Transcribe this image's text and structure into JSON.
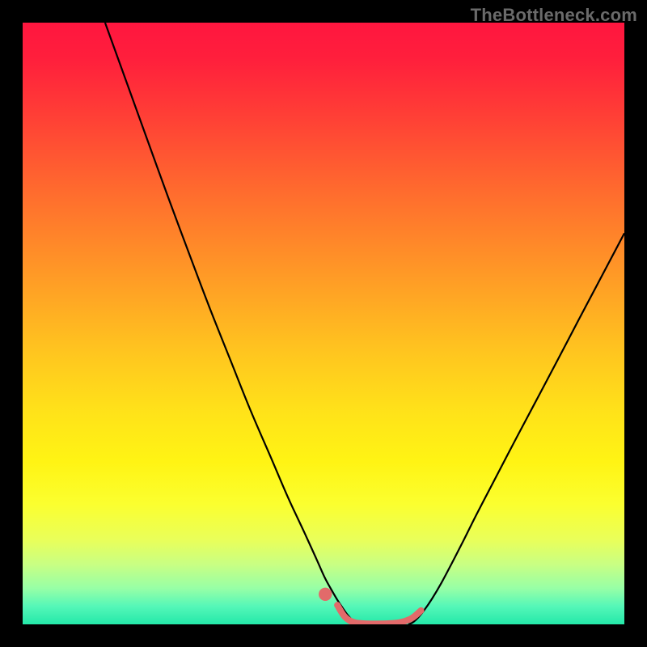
{
  "watermark": "TheBottleneck.com",
  "chart_data": {
    "type": "line",
    "title": "",
    "xlabel": "",
    "ylabel": "",
    "xlim": [
      0,
      100
    ],
    "ylim": [
      0,
      100
    ],
    "grid": false,
    "series": [
      {
        "name": "left-curve",
        "stroke": "#000000",
        "stroke_width": 2.2,
        "points": [
          {
            "x": 13.7,
            "y": 100.0
          },
          {
            "x": 17.2,
            "y": 90.3
          },
          {
            "x": 20.7,
            "y": 80.6
          },
          {
            "x": 24.1,
            "y": 71.2
          },
          {
            "x": 27.6,
            "y": 61.8
          },
          {
            "x": 31.0,
            "y": 52.8
          },
          {
            "x": 34.5,
            "y": 44.0
          },
          {
            "x": 37.9,
            "y": 35.5
          },
          {
            "x": 41.4,
            "y": 27.4
          },
          {
            "x": 44.1,
            "y": 21.1
          },
          {
            "x": 46.9,
            "y": 15.1
          },
          {
            "x": 48.9,
            "y": 10.7
          },
          {
            "x": 50.2,
            "y": 7.8
          },
          {
            "x": 51.4,
            "y": 5.6
          },
          {
            "x": 52.4,
            "y": 3.9
          },
          {
            "x": 53.2,
            "y": 2.7
          },
          {
            "x": 53.9,
            "y": 1.7
          },
          {
            "x": 54.6,
            "y": 0.9
          },
          {
            "x": 55.3,
            "y": 0.3
          },
          {
            "x": 55.9,
            "y": 0.0
          }
        ]
      },
      {
        "name": "right-curve",
        "stroke": "#000000",
        "stroke_width": 2.2,
        "points": [
          {
            "x": 64.1,
            "y": 0.0
          },
          {
            "x": 64.8,
            "y": 0.3
          },
          {
            "x": 65.7,
            "y": 1.1
          },
          {
            "x": 66.7,
            "y": 2.3
          },
          {
            "x": 68.0,
            "y": 4.2
          },
          {
            "x": 69.6,
            "y": 6.9
          },
          {
            "x": 71.3,
            "y": 10.1
          },
          {
            "x": 73.3,
            "y": 14.0
          },
          {
            "x": 75.5,
            "y": 18.4
          },
          {
            "x": 78.0,
            "y": 23.2
          },
          {
            "x": 80.7,
            "y": 28.4
          },
          {
            "x": 83.5,
            "y": 33.7
          },
          {
            "x": 86.2,
            "y": 38.8
          },
          {
            "x": 89.0,
            "y": 44.1
          },
          {
            "x": 92.4,
            "y": 50.6
          },
          {
            "x": 95.2,
            "y": 55.9
          },
          {
            "x": 100.0,
            "y": 65.0
          }
        ]
      },
      {
        "name": "valley-floor",
        "stroke": "#e26a6a",
        "stroke_width": 8,
        "linecap": "round",
        "points": [
          {
            "x": 52.3,
            "y": 3.2
          },
          {
            "x": 53.6,
            "y": 1.2
          },
          {
            "x": 55.2,
            "y": 0.3
          },
          {
            "x": 57.4,
            "y": 0.1
          },
          {
            "x": 59.7,
            "y": 0.1
          },
          {
            "x": 61.8,
            "y": 0.2
          },
          {
            "x": 63.4,
            "y": 0.5
          },
          {
            "x": 64.8,
            "y": 1.1
          },
          {
            "x": 66.2,
            "y": 2.3
          }
        ]
      }
    ],
    "markers": [
      {
        "name": "valley-dot",
        "x": 50.3,
        "y": 5.0,
        "r": 1.1,
        "fill": "#e26a6a"
      }
    ],
    "background_gradient_stops": [
      {
        "pos": 0,
        "color": "#ff163f"
      },
      {
        "pos": 28,
        "color": "#ff6b2e"
      },
      {
        "pos": 55,
        "color": "#ffc61f"
      },
      {
        "pos": 80,
        "color": "#fbff2f"
      },
      {
        "pos": 100,
        "color": "#24e8a9"
      }
    ]
  }
}
